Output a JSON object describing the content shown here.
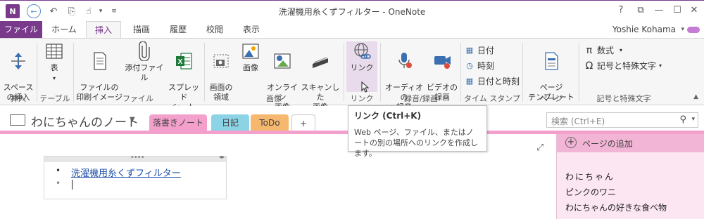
{
  "window": {
    "title": "洗濯機用糸くずフィルター - OneNote",
    "app_logo": "N",
    "controls": [
      "?",
      "⧉",
      "—",
      "☐",
      "✕"
    ]
  },
  "quick_access": {
    "back_icon": "back-arrow-icon",
    "undo_icon": "undo-icon",
    "touch_icon": "touch-mode-icon",
    "customize_icon": "customize-icon"
  },
  "tabs": [
    {
      "label": "ファイル"
    },
    {
      "label": "ホーム"
    },
    {
      "label": "挿入"
    },
    {
      "label": "描画"
    },
    {
      "label": "履歴"
    },
    {
      "label": "校閲"
    },
    {
      "label": "表示"
    }
  ],
  "user": {
    "name": "Yoshie Kohama"
  },
  "ribbon": {
    "buttons": {
      "space": "スペース\nの挿入",
      "table": "表",
      "printout": "ファイルの\n印刷イメージ",
      "attach": "添付ファイル",
      "spreadsheet": "スプレッド\nシート",
      "screen_clip": "画面の\n領域",
      "picture": "画像",
      "online_picture": "オンライン\n画像",
      "scanned": "スキャンした\n画像",
      "link": "リンク",
      "audio": "オーディオの\n録音",
      "video": "ビデオの\n録画",
      "date": "日付",
      "time": "時刻",
      "datetime": "日付と時刻",
      "page_template": "ページ\nテンプレート",
      "equation": "数式",
      "symbol": "記号と特殊文字"
    },
    "groups": {
      "insert": "挿入",
      "tables": "テーブル",
      "files": "ファイル",
      "images": "画像",
      "links": "リンク",
      "recording": "録音/録画",
      "timestamp": "タイム スタンプ",
      "pages": "ページ",
      "symbols": "記号と特殊文字"
    }
  },
  "notebook": {
    "name": "わにちゃんのノート",
    "sections": [
      {
        "label": "落書きノート",
        "color": "#f3a0cc"
      },
      {
        "label": "日記",
        "color": "#8dd3e6"
      },
      {
        "label": "ToDo",
        "color": "#f5b86e"
      },
      {
        "label": "+",
        "color": "#ffffff"
      }
    ]
  },
  "search": {
    "placeholder": "検索 (Ctrl+E)"
  },
  "note": {
    "link_text": "洗濯機用糸くずフィルター",
    "bullet": "•"
  },
  "page_pane": {
    "add_page": "ページの追加",
    "pages": [
      "わにちゃん",
      "ピンクのワニ",
      "わにちゃんの好きな食べ物"
    ]
  },
  "tooltip": {
    "title": "リンク (Ctrl+K)",
    "body": "Web ページ、ファイル、またはノートの別の場所へのリンクを作成します。"
  },
  "colors": {
    "accent": "#7a3a8c",
    "section_pink": "#f3a0cc",
    "page_pane": "#fbe6f1"
  }
}
